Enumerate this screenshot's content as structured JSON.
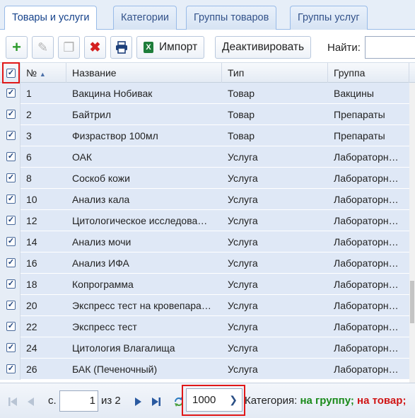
{
  "tabs": [
    {
      "label": "Товары и услуги",
      "active": true
    },
    {
      "label": "Категории",
      "active": false
    },
    {
      "label": "Группы товаров",
      "active": false
    },
    {
      "label": "Группы услуг",
      "active": false
    }
  ],
  "toolbar": {
    "import_label": "Импорт",
    "import_icon": "X",
    "deactivate_label": "Деактивировать",
    "find_label": "Найти:",
    "find_value": ""
  },
  "columns": {
    "num": "№",
    "name": "Название",
    "type": "Тип",
    "group": "Группа"
  },
  "rows": [
    {
      "num": "1",
      "name": "Вакцина Нобивак",
      "type": "Товар",
      "group": "Вакцины",
      "checked": true
    },
    {
      "num": "2",
      "name": "Байтрил",
      "type": "Товар",
      "group": "Препараты",
      "checked": true
    },
    {
      "num": "3",
      "name": "Физраствор 100мл",
      "type": "Товар",
      "group": "Препараты",
      "checked": true
    },
    {
      "num": "6",
      "name": "ОАК",
      "type": "Услуга",
      "group": "Лабораторн…",
      "checked": true
    },
    {
      "num": "8",
      "name": "Соскоб кожи",
      "type": "Услуга",
      "group": "Лабораторн…",
      "checked": true
    },
    {
      "num": "10",
      "name": "Анализ кала",
      "type": "Услуга",
      "group": "Лабораторн…",
      "checked": true
    },
    {
      "num": "12",
      "name": "Цитологическое исследова…",
      "type": "Услуга",
      "group": "Лабораторн…",
      "checked": true
    },
    {
      "num": "14",
      "name": "Анализ мочи",
      "type": "Услуга",
      "group": "Лабораторн…",
      "checked": true
    },
    {
      "num": "16",
      "name": "Анализ ИФА",
      "type": "Услуга",
      "group": "Лабораторн…",
      "checked": true
    },
    {
      "num": "18",
      "name": "Копрограмма",
      "type": "Услуга",
      "group": "Лабораторн…",
      "checked": true
    },
    {
      "num": "20",
      "name": "Экспресс тест на кровепара…",
      "type": "Услуга",
      "group": "Лабораторн…",
      "checked": true
    },
    {
      "num": "22",
      "name": "Экспресс тест",
      "type": "Услуга",
      "group": "Лабораторн…",
      "checked": true
    },
    {
      "num": "24",
      "name": "Цитология Влагалища",
      "type": "Услуга",
      "group": "Лабораторн…",
      "checked": true
    },
    {
      "num": "26",
      "name": "БАК (Печеночный)",
      "type": "Услуга",
      "group": "Лабораторн…",
      "checked": true
    }
  ],
  "pager": {
    "page_prefix": "с.",
    "page_value": "1",
    "of_text": "из 2",
    "page_size": "1000",
    "category_label": "Категория:",
    "to_group": "на группу;",
    "to_product": "на товар;"
  },
  "colors": {
    "accent": "#15428b",
    "row_bg": "#dfe8f6",
    "highlight_border": "#e01818",
    "green": "#1a8a1a",
    "red": "#d01515"
  }
}
